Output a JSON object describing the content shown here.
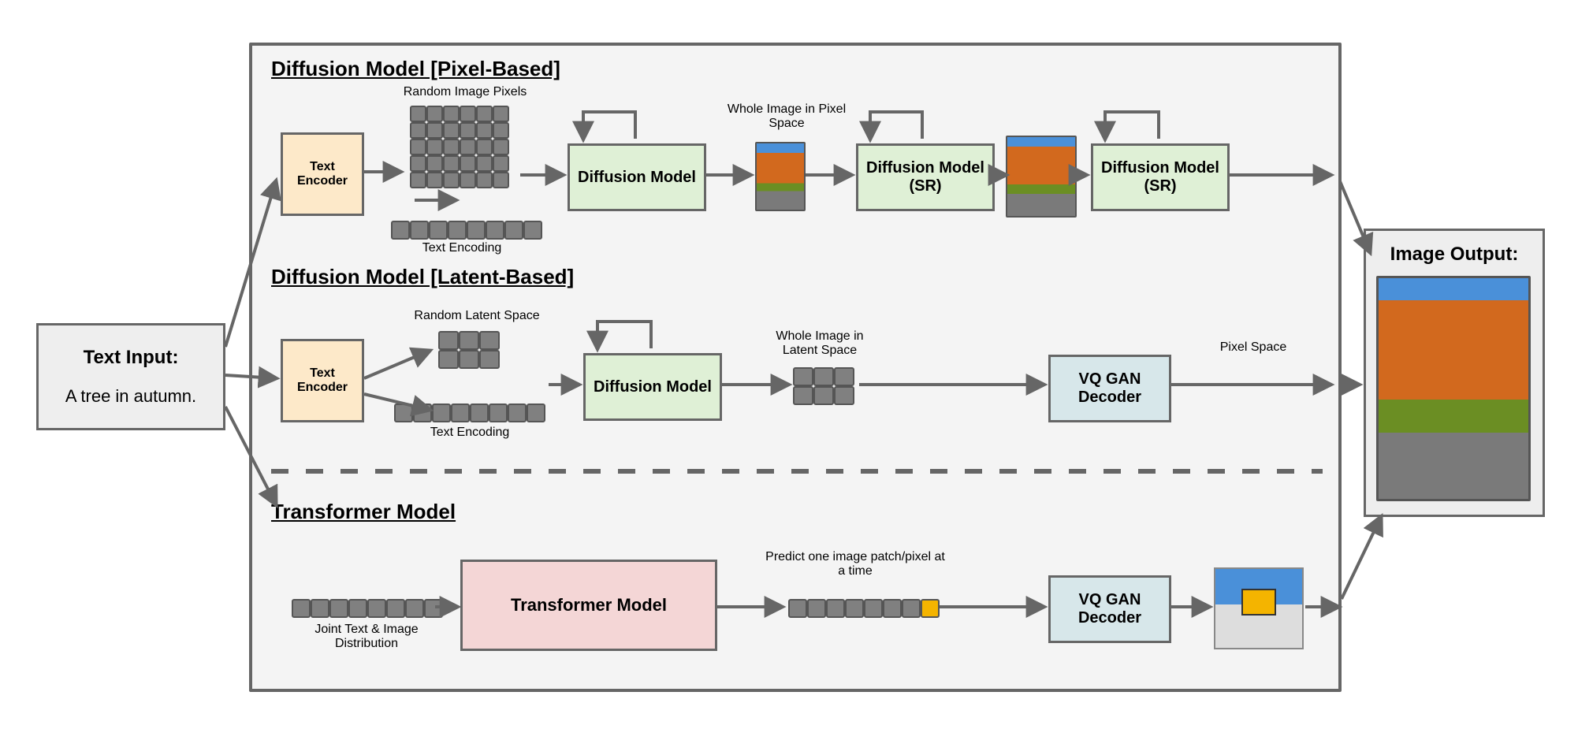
{
  "input": {
    "title": "Text Input:",
    "value": "A tree in autumn."
  },
  "output": {
    "title": "Image Output:"
  },
  "sections": {
    "pixel": "Diffusion Model [Pixel-Based]",
    "latent": "Diffusion Model [Latent-Based]",
    "transformer": "Transformer Model"
  },
  "labels": {
    "rand_pixels": "Random Image Pixels",
    "text_encoding": "Text Encoding",
    "whole_pixel": "Whole Image in Pixel Space",
    "rand_latent": "Random Latent Space",
    "whole_latent": "Whole Image in Latent Space",
    "text_encoding2": "Text Encoding",
    "pixel_space": "Pixel Space",
    "joint": "Joint Text & Image Distribution",
    "predict": "Predict one image patch/pixel at a time"
  },
  "nodes": {
    "enc1": "Text Encoder",
    "enc2": "Text Encoder",
    "diff1": "Diffusion Model",
    "diff_sr1": "Diffusion Model (SR)",
    "diff_sr2": "Diffusion Model (SR)",
    "diff2": "Diffusion Model",
    "dec1": "VQ GAN Decoder",
    "dec2": "VQ GAN Decoder",
    "transformer": "Transformer Model"
  }
}
